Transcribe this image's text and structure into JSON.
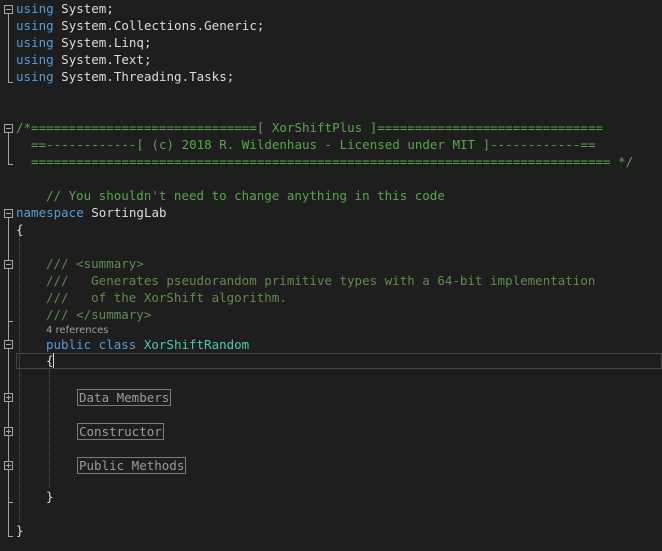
{
  "code": {
    "using_keyword": "using",
    "usings": [
      "System;",
      "System.Collections.Generic;",
      "System.Linq;",
      "System.Text;",
      "System.Threading.Tasks;"
    ],
    "header_comment_lines": [
      "/*==============================[ XorShiftPlus ]==============================",
      "  ==------------[ (c) 2018 R. Wildenhaus - Licensed under MIT ]------------==",
      "  ============================================================================= */"
    ],
    "note_comment": "// You shouldn't need to change anything in this code",
    "namespace_keyword": "namespace",
    "namespace_name": "SortingLab",
    "open_brace": "{",
    "close_brace": "}",
    "doc_lines": [
      "/// <summary>",
      "///   Generates pseudorandom primitive types with a 64-bit implementation",
      "///   of the XorShift algorithm.",
      "/// </summary>"
    ],
    "references": "4 references",
    "class_keywords": "public class",
    "class_name": "XorShiftRandom",
    "regions": [
      "Data Members",
      "Constructor",
      "Public Methods"
    ]
  }
}
